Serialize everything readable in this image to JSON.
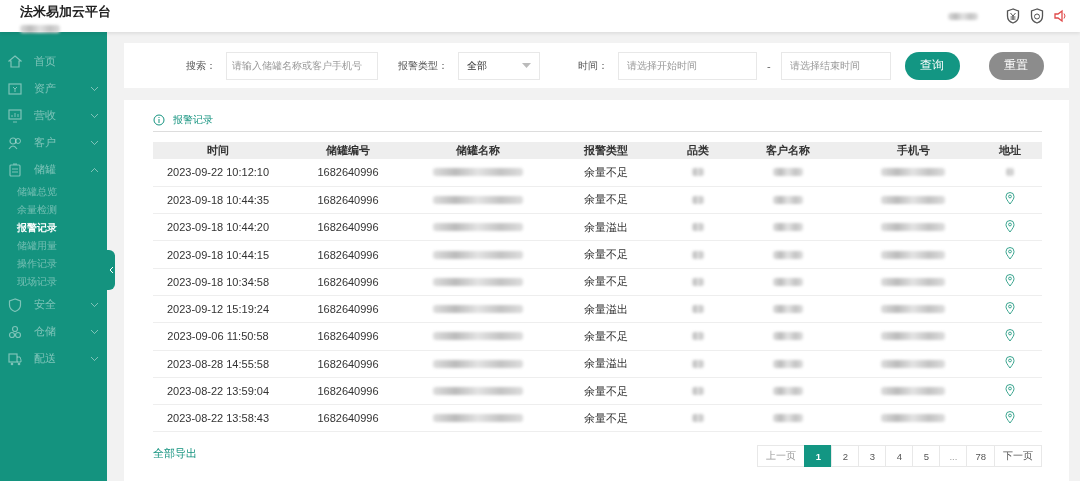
{
  "header": {
    "title": "法米易加云平台",
    "user_masked": true
  },
  "sidebar": {
    "items": [
      {
        "label": "首页"
      },
      {
        "label": "资产",
        "expanded": false
      },
      {
        "label": "营收",
        "expanded": false
      },
      {
        "label": "客户",
        "expanded": false
      },
      {
        "label": "储罐",
        "expanded": true,
        "children": [
          {
            "label": "储罐总览",
            "selected": false
          },
          {
            "label": "余量检测",
            "selected": false
          },
          {
            "label": "报警记录",
            "selected": true
          },
          {
            "label": "储罐用量",
            "selected": false
          },
          {
            "label": "操作记录",
            "selected": false
          },
          {
            "label": "现场记录",
            "selected": false
          }
        ]
      },
      {
        "label": "安全",
        "expanded": false
      },
      {
        "label": "仓储",
        "expanded": false
      },
      {
        "label": "配送",
        "expanded": false
      }
    ]
  },
  "filters": {
    "search_label": "搜索：",
    "search_placeholder": "请输入储罐名称或客户手机号",
    "type_label": "报警类型：",
    "type_value": "全部",
    "time_label": "时间：",
    "start_placeholder": "请选择开始时间",
    "range_sep": "-",
    "end_placeholder": "请选择结束时间",
    "query_button": "查询",
    "reset_button": "重置"
  },
  "section_title": "报警记录",
  "table": {
    "columns": [
      "时间",
      "储罐编号",
      "储罐名称",
      "报警类型",
      "品类",
      "客户名称",
      "手机号",
      "地址"
    ],
    "rows": [
      {
        "time": "2023-09-22 10:12:10",
        "tank_no": "1682640996",
        "alarm_type": "余量不足",
        "masked": true,
        "location": false
      },
      {
        "time": "2023-09-18 10:44:35",
        "tank_no": "1682640996",
        "alarm_type": "余量不足",
        "masked": true,
        "location": true
      },
      {
        "time": "2023-09-18 10:44:20",
        "tank_no": "1682640996",
        "alarm_type": "余量溢出",
        "masked": true,
        "location": true
      },
      {
        "time": "2023-09-18 10:44:15",
        "tank_no": "1682640996",
        "alarm_type": "余量不足",
        "masked": true,
        "location": true
      },
      {
        "time": "2023-09-18 10:34:58",
        "tank_no": "1682640996",
        "alarm_type": "余量不足",
        "masked": true,
        "location": true
      },
      {
        "time": "2023-09-12 15:19:24",
        "tank_no": "1682640996",
        "alarm_type": "余量溢出",
        "masked": true,
        "location": true
      },
      {
        "time": "2023-09-06 11:50:58",
        "tank_no": "1682640996",
        "alarm_type": "余量不足",
        "masked": true,
        "location": true
      },
      {
        "time": "2023-08-28 14:55:58",
        "tank_no": "1682640996",
        "alarm_type": "余量溢出",
        "masked": true,
        "location": true
      },
      {
        "time": "2023-08-22 13:59:04",
        "tank_no": "1682640996",
        "alarm_type": "余量不足",
        "masked": true,
        "location": true
      },
      {
        "time": "2023-08-22 13:58:43",
        "tank_no": "1682640996",
        "alarm_type": "余量不足",
        "masked": true,
        "location": true
      }
    ]
  },
  "export_link": "全部导出",
  "pagination": [
    {
      "label": "上一页",
      "kind": "prev",
      "disabled": true,
      "selected": false
    },
    {
      "label": "1",
      "kind": "page",
      "disabled": false,
      "selected": true
    },
    {
      "label": "2",
      "kind": "page",
      "disabled": false,
      "selected": false
    },
    {
      "label": "3",
      "kind": "page",
      "disabled": false,
      "selected": false
    },
    {
      "label": "4",
      "kind": "page",
      "disabled": false,
      "selected": false
    },
    {
      "label": "5",
      "kind": "page",
      "disabled": false,
      "selected": false
    },
    {
      "label": "...",
      "kind": "ellipsis",
      "disabled": true,
      "selected": false
    },
    {
      "label": "78",
      "kind": "page",
      "disabled": false,
      "selected": false
    },
    {
      "label": "下一页",
      "kind": "next",
      "disabled": false,
      "selected": false
    }
  ]
}
